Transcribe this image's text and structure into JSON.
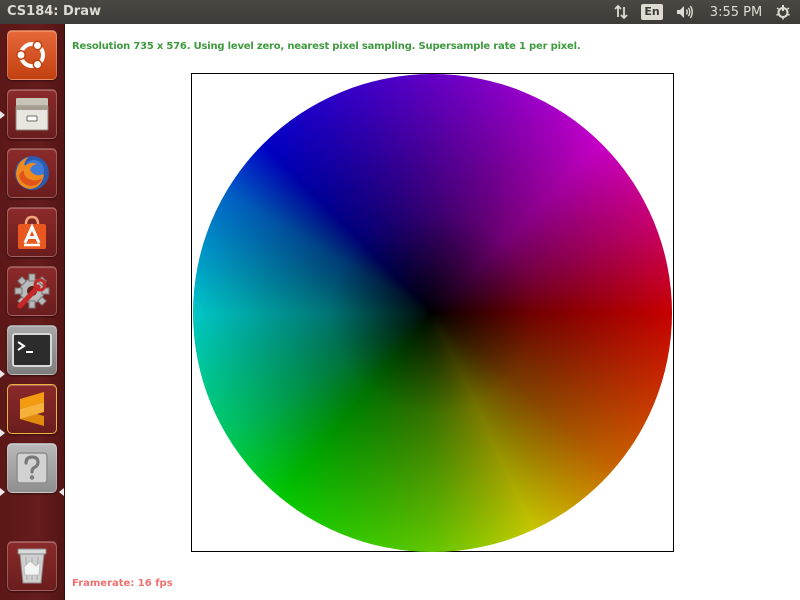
{
  "window": {
    "title": "CS184: Draw"
  },
  "panel": {
    "language": "En",
    "clock": "3:55 PM"
  },
  "launcher": {
    "items": [
      {
        "name": "ubuntu-dash",
        "icon": "ubuntu-logo-icon"
      },
      {
        "name": "files",
        "icon": "file-cabinet-icon"
      },
      {
        "name": "firefox",
        "icon": "firefox-icon"
      },
      {
        "name": "software-center",
        "icon": "shopping-bag-icon"
      },
      {
        "name": "system-settings",
        "icon": "gear-wrench-icon"
      },
      {
        "name": "terminal",
        "icon": "terminal-icon"
      },
      {
        "name": "sublime-text",
        "icon": "sublime-s-icon"
      },
      {
        "name": "unknown-app",
        "icon": "question-mark-icon"
      },
      {
        "name": "trash",
        "icon": "trash-icon"
      }
    ],
    "colors": {
      "background": "#5c1717",
      "ubuntu": "#dd4814",
      "sublime": "#f39c12"
    }
  },
  "app": {
    "status": "Resolution 735 x 576. Using level zero, nearest pixel sampling. Supersample rate 1 per pixel.",
    "framerate": "Framerate: 16 fps",
    "status_color": "#3f9a3f",
    "framerate_color": "#f07070"
  }
}
